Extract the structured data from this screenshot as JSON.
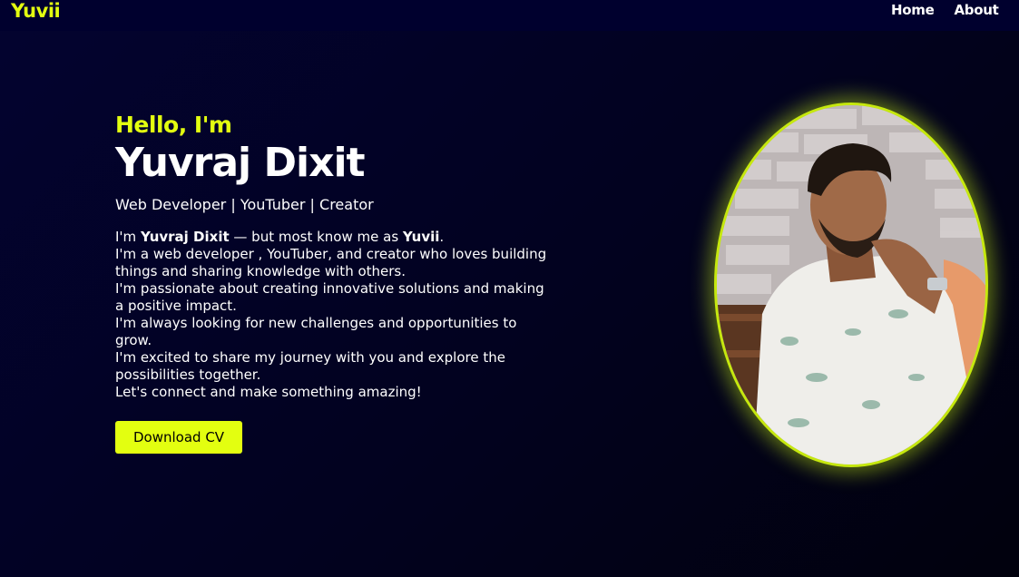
{
  "navbar": {
    "logo": "Yuvii",
    "links": [
      "Home",
      "About"
    ]
  },
  "hero": {
    "greeting": "Hello, I'm",
    "name": "Yuvraj Dixit",
    "tagline": "Web Developer | YouTuber | Creator",
    "bio_intro_prefix": "I'm ",
    "bio_intro_name": "Yuvraj Dixit",
    "bio_intro_middle": " — but most know me as ",
    "bio_intro_nick": "Yuvii",
    "bio_intro_suffix": ".",
    "bio_lines": [
      "I'm a web developer , YouTuber, and creator who loves building things and sharing knowledge with others.",
      "I'm passionate about creating innovative solutions and making a positive impact.",
      "I'm always looking for new challenges and opportunities to grow.",
      "I'm excited to share my journey with you and explore the possibilities together.",
      "Let's connect and make something amazing!"
    ],
    "cv_button": "Download CV"
  },
  "colors": {
    "accent": "#e3ff10",
    "background": "#02021f",
    "navbar": "#00002e"
  },
  "icons": {
    "portrait": "profile-photo"
  }
}
